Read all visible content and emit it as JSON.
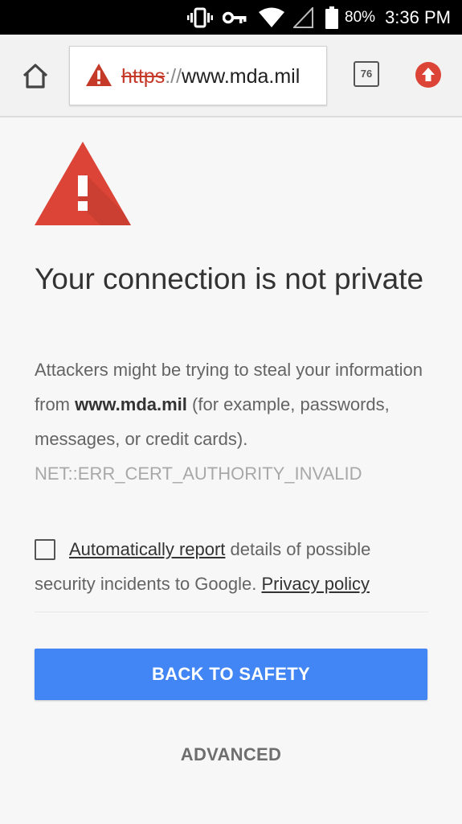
{
  "status_bar": {
    "icons": [
      "vibrate-icon",
      "vpn-key-icon",
      "wifi-icon",
      "signal-icon",
      "battery-icon"
    ],
    "battery": "80%",
    "time": "3:36 PM"
  },
  "toolbar": {
    "home_icon": "home-icon",
    "url": {
      "scheme": "https",
      "separator": "://",
      "host": "www.mda.mil"
    },
    "tab_count": "76",
    "update_icon": "update-arrow-icon"
  },
  "interstitial": {
    "heading": "Your connection is not private",
    "description": {
      "part1": "Attackers might be trying to steal your information from ",
      "domain": "www.mda.mil",
      "part2": " (for example, passwords, messages, or credit cards). ",
      "error_code": "NET::ERR_CERT_AUTHORITY_INVALID"
    },
    "report": {
      "checked": false,
      "link_text": "Automatically report",
      "text": " details of possible security incidents to Google. ",
      "privacy_link": "Privacy policy"
    },
    "primary_button": "BACK TO SAFETY",
    "advanced_button": "ADVANCED"
  },
  "colors": {
    "warning_red": "#db4437",
    "primary_blue": "#4285f4",
    "status_bar": "#000000"
  }
}
